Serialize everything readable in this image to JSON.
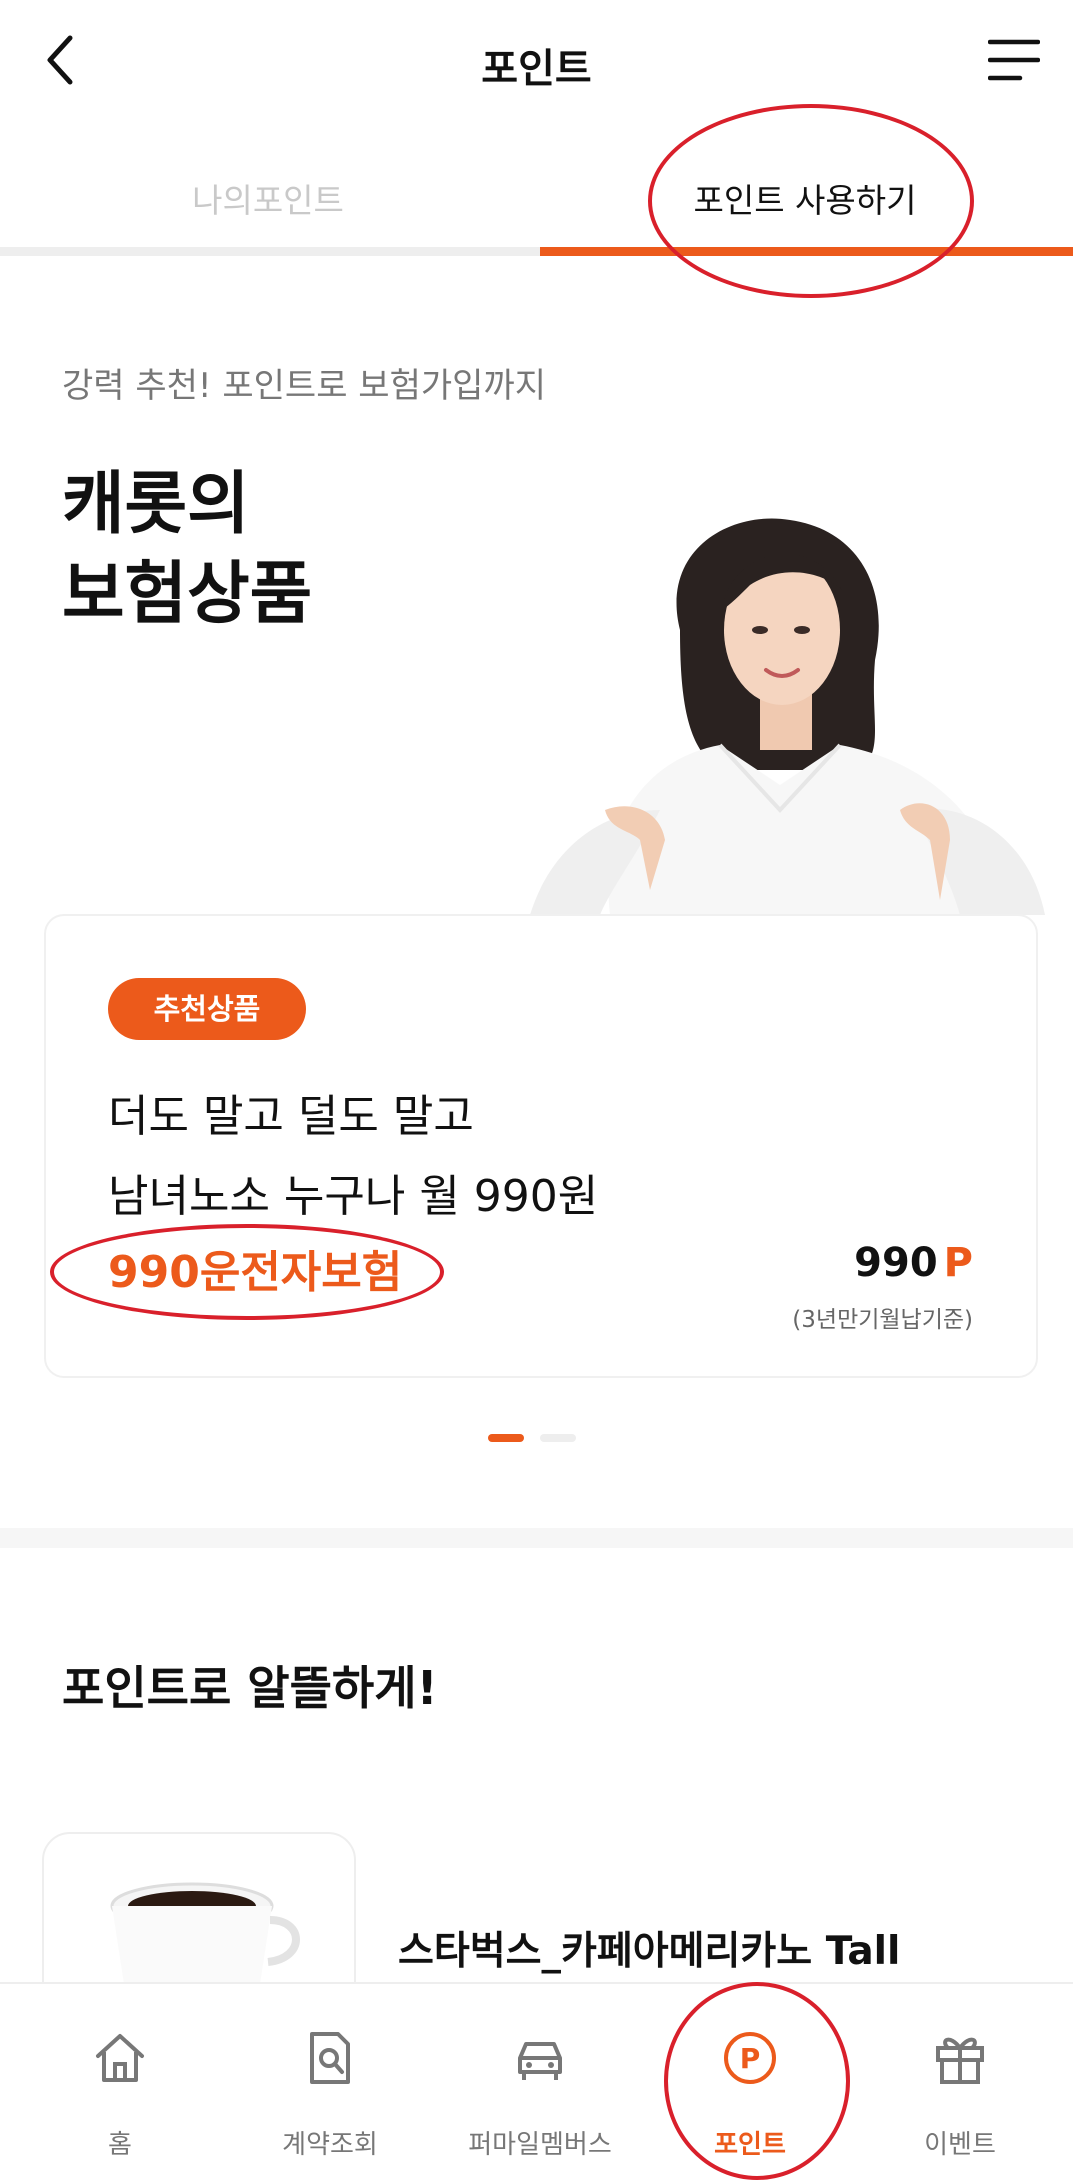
{
  "header": {
    "title": "포인트",
    "back_icon": "chevron-left-icon",
    "menu_icon": "menu-icon"
  },
  "tabs": [
    {
      "label": "나의포인트",
      "active": false
    },
    {
      "label": "포인트 사용하기",
      "active": true
    }
  ],
  "promo": {
    "subtitle": "강력 추천! 포인트로 보험가입까지",
    "headline_line1": "캐롯의",
    "headline_line2": "보험상품"
  },
  "featured_card": {
    "badge": "추천상품",
    "line1": "더도 말고 덜도 말고",
    "line2": "남녀노소 누구나 월 990원",
    "product_name": "990운전자보험",
    "price": "990",
    "price_unit": "P",
    "price_note": "(3년만기월납기준)"
  },
  "carousel": {
    "count": 2,
    "active_index": 0
  },
  "section": {
    "title": "포인트로 알뜰하게!"
  },
  "product": {
    "name": "스타벅스_카페아메리카노 Tall",
    "icon": "coffee-cup-icon"
  },
  "bottom_nav": [
    {
      "label": "홈",
      "icon": "home-icon",
      "active": false
    },
    {
      "label": "계약조회",
      "icon": "document-search-icon",
      "active": false
    },
    {
      "label": "퍼마일멤버스",
      "icon": "car-icon",
      "active": false
    },
    {
      "label": "포인트",
      "icon": "point-coin-icon",
      "active": true
    },
    {
      "label": "이벤트",
      "icon": "gift-icon",
      "active": false
    }
  ],
  "colors": {
    "accent": "#ec5a1b",
    "annotation": "#d9202b"
  }
}
